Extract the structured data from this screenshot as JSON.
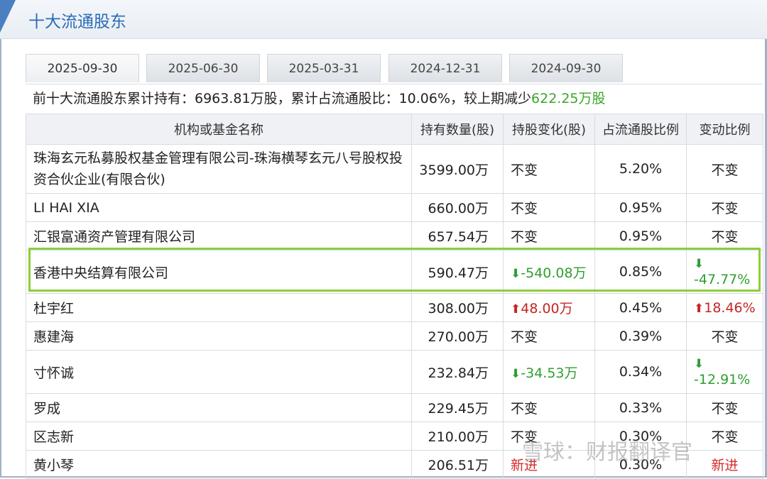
{
  "header": {
    "title": "十大流通股东"
  },
  "tabs": [
    "2025-09-30",
    "2025-06-30",
    "2025-03-31",
    "2024-12-31",
    "2024-09-30"
  ],
  "summary": {
    "prefix": "前十大流通股东累计持有：6963.81万股，累计占流通股比：10.06%，较上期减少",
    "decrease": "622.25万股"
  },
  "table": {
    "headers": [
      "机构或基金名称",
      "持有数量(股)",
      "持股变化(股)",
      "占流通股比例",
      "变动比例"
    ],
    "rows": [
      {
        "name": "珠海玄元私募股权基金管理有限公司-珠海横琴玄元八号股权投资合伙企业(有限合伙)",
        "shares": "3599.00万",
        "change": "不变",
        "ratio": "5.20%",
        "change_pct": "不变"
      },
      {
        "name": "LI HAI XIA",
        "shares": "660.00万",
        "change": "不变",
        "ratio": "0.95%",
        "change_pct": "不变"
      },
      {
        "name": "汇银富通资产管理有限公司",
        "shares": "657.54万",
        "change": "不变",
        "ratio": "0.95%",
        "change_pct": "不变"
      },
      {
        "name": "香港中央结算有限公司",
        "shares": "590.47万",
        "change": "-540.08万",
        "ratio": "0.85%",
        "change_pct": "-47.77%"
      },
      {
        "name": "杜宇红",
        "shares": "308.00万",
        "change": "48.00万",
        "ratio": "0.45%",
        "change_pct": "18.46%"
      },
      {
        "name": "惠建海",
        "shares": "270.00万",
        "change": "不变",
        "ratio": "0.39%",
        "change_pct": "不变"
      },
      {
        "name": "寸怀诚",
        "shares": "232.84万",
        "change": "-34.53万",
        "ratio": "0.34%",
        "change_pct": "-12.91%"
      },
      {
        "name": "罗成",
        "shares": "229.45万",
        "change": "不变",
        "ratio": "0.33%",
        "change_pct": "不变"
      },
      {
        "name": "区志新",
        "shares": "210.00万",
        "change": "不变",
        "ratio": "0.30%",
        "change_pct": "不变"
      },
      {
        "name": "黄小琴",
        "shares": "206.51万",
        "change": "新进",
        "ratio": "0.30%",
        "change_pct": "新进"
      }
    ]
  },
  "colors": {
    "accent": "#2a6bb5",
    "increase": "#c62424",
    "decrease": "#2f9e2f",
    "highlight": "#8ccf3a"
  },
  "icons": {
    "up": "arrow-up-icon",
    "down": "arrow-down-icon"
  },
  "watermark": "雪球：财报翻译官"
}
